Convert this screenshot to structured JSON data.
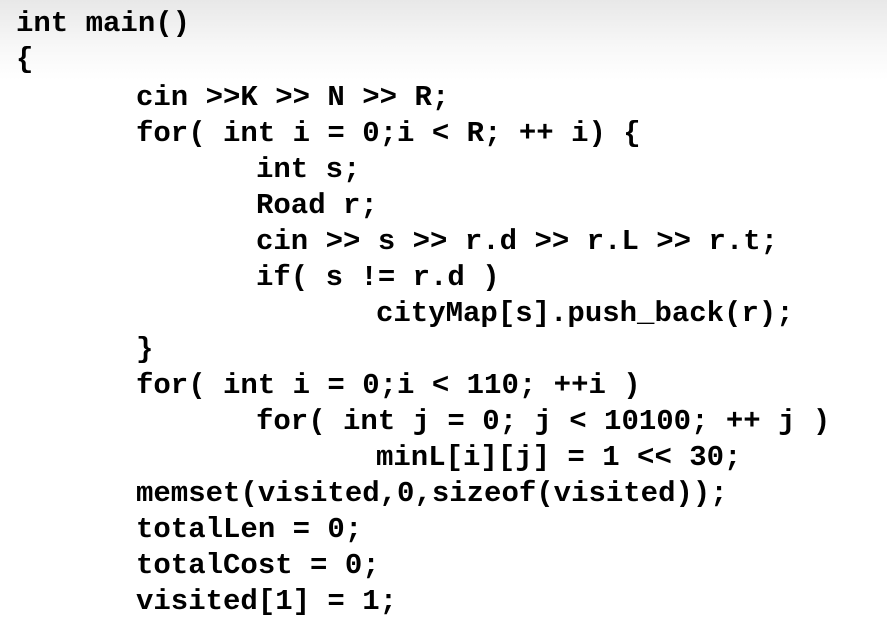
{
  "code_lines": [
    "int main()",
    "{",
    "cin >>K >> N >> R;",
    "for( int i = 0;i < R; ++ i) {",
    "int s;",
    "Road r;",
    "cin >> s >> r.d >> r.L >> r.t;",
    "if( s != r.d )",
    "cityMap[s].push_back(r);",
    "}",
    "for( int i = 0;i < 110; ++i )",
    "for( int j = 0; j < 10100; ++ j )",
    "minL[i][j] = 1 << 30;",
    "memset(visited,0,sizeof(visited));",
    "totalLen = 0;",
    "totalCost = 0;",
    "visited[1] = 1;"
  ]
}
